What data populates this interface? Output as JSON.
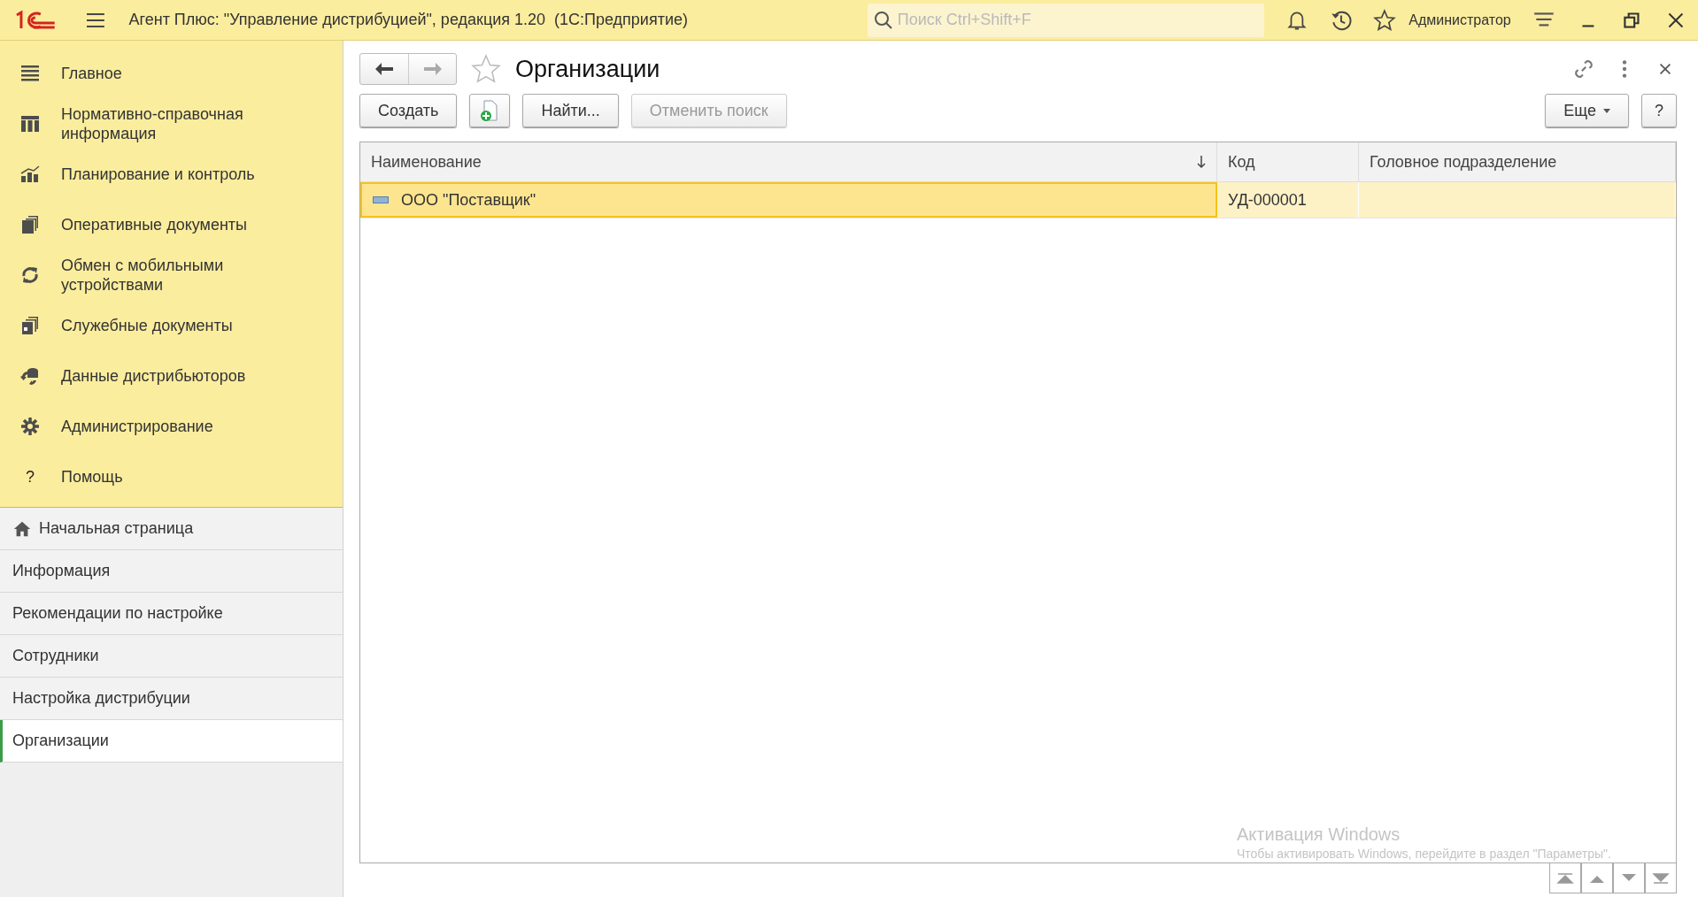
{
  "window": {
    "title": "Агент Плюс: \"Управление дистрибуцией\", редакция 1.20  (1С:Предприятие)",
    "search_placeholder": "Поиск Ctrl+Shift+F",
    "user": "Администратор"
  },
  "sidebar": {
    "items": [
      {
        "label": "Главное"
      },
      {
        "label": "Нормативно-справочная информация"
      },
      {
        "label": "Планирование и контроль"
      },
      {
        "label": "Оперативные документы"
      },
      {
        "label": "Обмен с мобильными устройствами"
      },
      {
        "label": "Служебные документы"
      },
      {
        "label": "Данные дистрибьюторов"
      },
      {
        "label": "Администрирование"
      },
      {
        "label": "?",
        "kind": "glyph",
        "text": "Помощь"
      }
    ]
  },
  "sections": [
    {
      "label": "Начальная страница",
      "kind": "home",
      "selected": false
    },
    {
      "label": "Информация",
      "kind": "plain",
      "selected": false
    },
    {
      "label": "Рекомендации по настройке",
      "kind": "plain",
      "selected": false
    },
    {
      "label": "Сотрудники",
      "kind": "plain",
      "selected": false
    },
    {
      "label": "Настройка дистрибуции",
      "kind": "plain",
      "selected": false
    },
    {
      "label": "Организации",
      "kind": "plain",
      "selected": true
    }
  ],
  "form": {
    "title": "Организации",
    "toolbar": [
      {
        "label": "Создать",
        "kind": "text",
        "disabled": false
      },
      {
        "kind": "add-copy",
        "disabled": false
      },
      {
        "label": "Найти...",
        "kind": "text",
        "disabled": false
      },
      {
        "label": "Отменить поиск",
        "kind": "text",
        "disabled": true
      }
    ],
    "more": "Еще",
    "help": "?",
    "table": {
      "columns": [
        {
          "label": "Наименование",
          "sorted": true
        },
        {
          "label": "Код",
          "sorted": false
        },
        {
          "label": "Головное подразделение",
          "sorted": false
        }
      ],
      "rows": [
        {
          "cells": [
            "ООО \"Поставщик\"",
            "УД-000001",
            ""
          ],
          "selected": true
        }
      ]
    }
  },
  "activation_notice": {
    "title": "Активация Windows",
    "text": "Чтобы активировать Windows, перейдите в раздел \"Параметры\"."
  }
}
